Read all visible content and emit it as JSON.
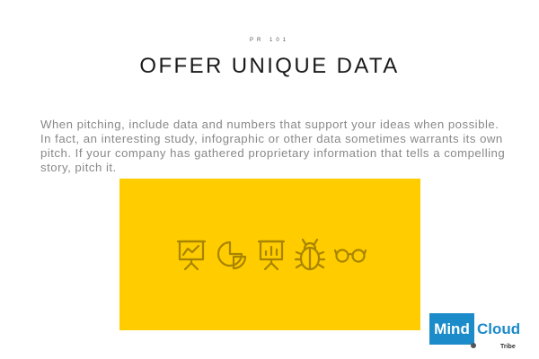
{
  "slide": {
    "kicker": "PR 101",
    "title": "OFFER UNIQUE DATA",
    "body": "When pitching, include data and numbers that support your ideas when possible. In fact, an interesting study, infographic or other data sometimes warrants its own pitch. If your company has gathered proprietary information that tells a compelling story, pitch it."
  },
  "panel": {
    "color": "#ffcc00",
    "icons": [
      "presentation-chart-icon",
      "pie-chart-icon",
      "bar-chart-board-icon",
      "bug-icon",
      "glasses-icon"
    ],
    "icon_color": "#a88400"
  },
  "logo": {
    "mind": "Mind",
    "cloud": "Cloud",
    "tribe": "Tribe",
    "brand_color": "#1b8bc9"
  }
}
